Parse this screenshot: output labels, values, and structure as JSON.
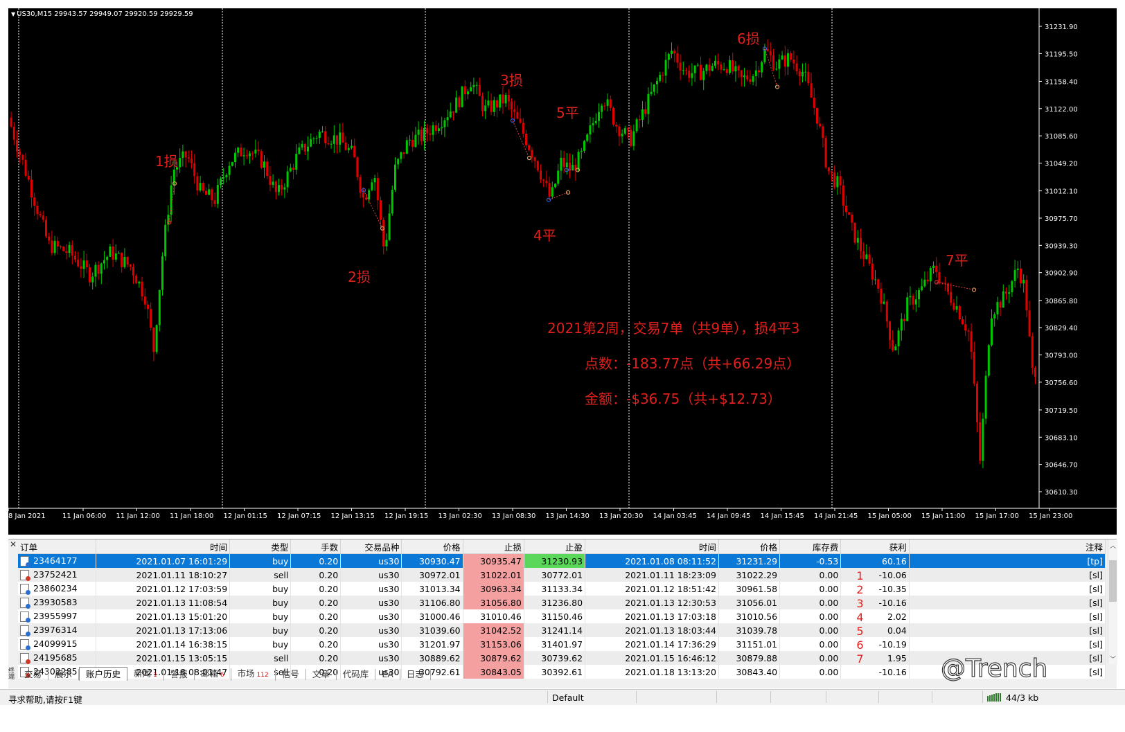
{
  "chart": {
    "title": "US30,M15  29943.57 29949.07 29920.59 29929.59",
    "price_labels": [
      "31231.90",
      "31195.50",
      "31158.40",
      "31122.00",
      "31085.60",
      "31049.20",
      "31012.10",
      "30975.70",
      "30939.30",
      "30902.90",
      "30865.80",
      "30829.40",
      "30793.00",
      "30756.60",
      "30719.50",
      "30683.10",
      "30646.70",
      "30610.30"
    ],
    "time_labels": [
      "8 Jan 2021",
      "11 Jan 06:00",
      "11 Jan 12:00",
      "11 Jan 18:00",
      "12 Jan 01:15",
      "12 Jan 07:15",
      "12 Jan 13:15",
      "12 Jan 19:15",
      "13 Jan 02:30",
      "13 Jan 08:30",
      "13 Jan 14:30",
      "13 Jan 20:30",
      "14 Jan 03:45",
      "14 Jan 09:45",
      "14 Jan 15:45",
      "14 Jan 21:45",
      "15 Jan 05:00",
      "15 Jan 11:00",
      "15 Jan 17:00",
      "15 Jan 23:00"
    ],
    "annotations": [
      "1损",
      "2损",
      "3损",
      "4平",
      "5平",
      "6损",
      "7平"
    ],
    "summary": {
      "line1": "2021第2周，交易7单（共9单），损4平3",
      "line2": "点数：-183.77点（共+66.29点）",
      "line3": "金额：-$36.75（共+$12.73）"
    },
    "colors": {
      "bull": "#00c800",
      "bear": "#e00000",
      "background": "#000000"
    }
  },
  "table": {
    "headers": [
      "订单",
      "时间",
      "类型",
      "手数",
      "交易品种",
      "价格",
      "止损",
      "止盈",
      "时间",
      "价格",
      "库存费",
      "获利",
      "注释"
    ],
    "rows": [
      {
        "order": "23464177",
        "open_time": "2021.01.07 16:01:29",
        "type": "buy",
        "lots": "0.20",
        "symbol": "us30",
        "price": "30930.47",
        "sl": "30935.47",
        "tp": "31230.93",
        "close_time": "2021.01.08 08:11:52",
        "close_price": "31231.29",
        "swap": "-0.53",
        "profit": "60.16",
        "comment": "[tp]",
        "idx": ""
      },
      {
        "order": "23752421",
        "open_time": "2021.01.11 18:10:27",
        "type": "sell",
        "lots": "0.20",
        "symbol": "us30",
        "price": "30972.01",
        "sl": "31022.01",
        "tp": "30772.01",
        "close_time": "2021.01.11 18:23:09",
        "close_price": "31022.29",
        "swap": "0.00",
        "profit": "-10.06",
        "comment": "[sl]",
        "idx": "1"
      },
      {
        "order": "23860234",
        "open_time": "2021.01.12 17:03:59",
        "type": "buy",
        "lots": "0.20",
        "symbol": "us30",
        "price": "31013.34",
        "sl": "30963.34",
        "tp": "31133.34",
        "close_time": "2021.01.12 18:51:42",
        "close_price": "30961.58",
        "swap": "0.00",
        "profit": "-10.35",
        "comment": "[sl]",
        "idx": "2"
      },
      {
        "order": "23930583",
        "open_time": "2021.01.13 11:08:54",
        "type": "buy",
        "lots": "0.20",
        "symbol": "us30",
        "price": "31106.80",
        "sl": "31056.80",
        "tp": "31236.80",
        "close_time": "2021.01.13 12:30:53",
        "close_price": "31056.01",
        "swap": "0.00",
        "profit": "-10.16",
        "comment": "[sl]",
        "idx": "3"
      },
      {
        "order": "23955997",
        "open_time": "2021.01.13 15:01:20",
        "type": "buy",
        "lots": "0.20",
        "symbol": "us30",
        "price": "31000.46",
        "sl": "31010.46",
        "tp": "31150.46",
        "close_time": "2021.01.13 17:03:18",
        "close_price": "31010.56",
        "swap": "0.00",
        "profit": "2.02",
        "comment": "[sl]",
        "idx": "4"
      },
      {
        "order": "23976314",
        "open_time": "2021.01.13 17:13:06",
        "type": "buy",
        "lots": "0.20",
        "symbol": "us30",
        "price": "31039.60",
        "sl": "31042.52",
        "tp": "31241.14",
        "close_time": "2021.01.13 18:03:44",
        "close_price": "31039.78",
        "swap": "0.00",
        "profit": "0.04",
        "comment": "[sl]",
        "idx": "5"
      },
      {
        "order": "24099915",
        "open_time": "2021.01.14 16:38:15",
        "type": "buy",
        "lots": "0.20",
        "symbol": "us30",
        "price": "31201.97",
        "sl": "31153.06",
        "tp": "31401.97",
        "close_time": "2021.01.14 17:36:29",
        "close_price": "31151.01",
        "swap": "0.00",
        "profit": "-10.19",
        "comment": "[sl]",
        "idx": "6"
      },
      {
        "order": "24195685",
        "open_time": "2021.01.15 13:05:15",
        "type": "sell",
        "lots": "0.20",
        "symbol": "us30",
        "price": "30889.62",
        "sl": "30879.62",
        "tp": "30739.62",
        "close_time": "2021.01.15 16:46:12",
        "close_price": "30879.88",
        "swap": "0.00",
        "profit": "1.95",
        "comment": "[sl]",
        "idx": "7"
      },
      {
        "order": "24302285",
        "open_time": "2021.01.18 08:01:47",
        "type": "sell",
        "lots": "0.20",
        "symbol": "us30",
        "price": "30792.61",
        "sl": "30843.05",
        "tp": "30392.61",
        "close_time": "2021.01.18 13:13:20",
        "close_price": "30843.40",
        "swap": "0.00",
        "profit": "-10.16",
        "comment": "[sl]",
        "idx": ""
      }
    ]
  },
  "tabs": [
    {
      "label": "交易",
      "badge": ""
    },
    {
      "label": "展示",
      "badge": ""
    },
    {
      "label": "账户历史",
      "badge": "",
      "active": true
    },
    {
      "label": "新闻",
      "badge": "1"
    },
    {
      "label": "警报",
      "badge": ""
    },
    {
      "label": "邮箱",
      "badge": "6"
    },
    {
      "label": "市场",
      "badge": "112"
    },
    {
      "label": "信号",
      "badge": ""
    },
    {
      "label": "文章",
      "badge": ""
    },
    {
      "label": "代码库",
      "badge": ""
    },
    {
      "label": "EA",
      "badge": ""
    },
    {
      "label": "日志",
      "badge": ""
    }
  ],
  "side_label": "终端",
  "status": {
    "help": "寻求帮助,请按F1键",
    "profile": "Default",
    "traffic": "44/3 kb"
  },
  "watermark": "@Trench"
}
